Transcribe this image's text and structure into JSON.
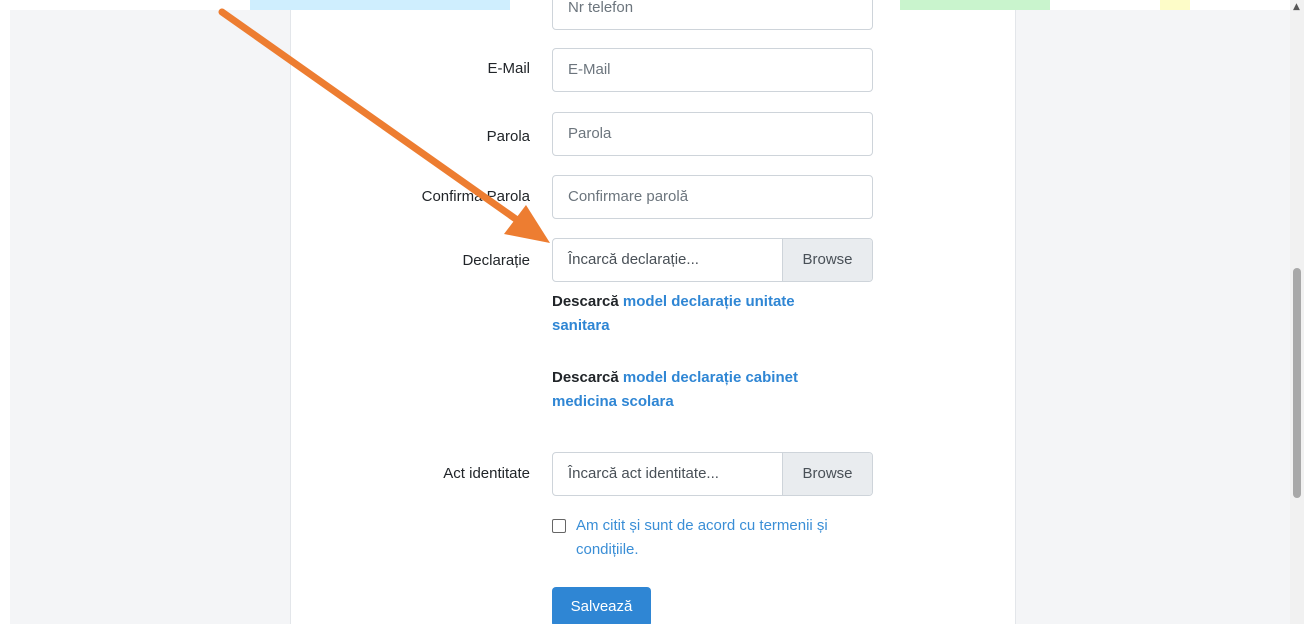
{
  "form": {
    "phone": {
      "placeholder": "Nr telefon"
    },
    "email": {
      "label": "E-Mail",
      "placeholder": "E-Mail"
    },
    "password": {
      "label": "Parola",
      "placeholder": "Parola"
    },
    "confirm": {
      "label": "Confirmă Parola",
      "placeholder": "Confirmare parolă"
    },
    "declaration": {
      "label": "Declarație",
      "placeholder": "Încarcă declarație...",
      "button": "Browse"
    },
    "download1": {
      "prefix": "Descarcă",
      "link": "model declarație unitate sanitara"
    },
    "download2": {
      "prefix": "Descarcă",
      "link": "model declarație cabinet medicina scolara"
    },
    "identity": {
      "label": "Act identitate",
      "placeholder": "Încarcă act identitate...",
      "button": "Browse"
    },
    "terms": "Am citit și sunt de acord cu termenii și condițiile.",
    "save": "Salvează"
  },
  "annotation": {
    "arrow_color": "#ed7d31"
  },
  "colors": {
    "primary": "#2f86d4",
    "link": "#2f86d4"
  }
}
